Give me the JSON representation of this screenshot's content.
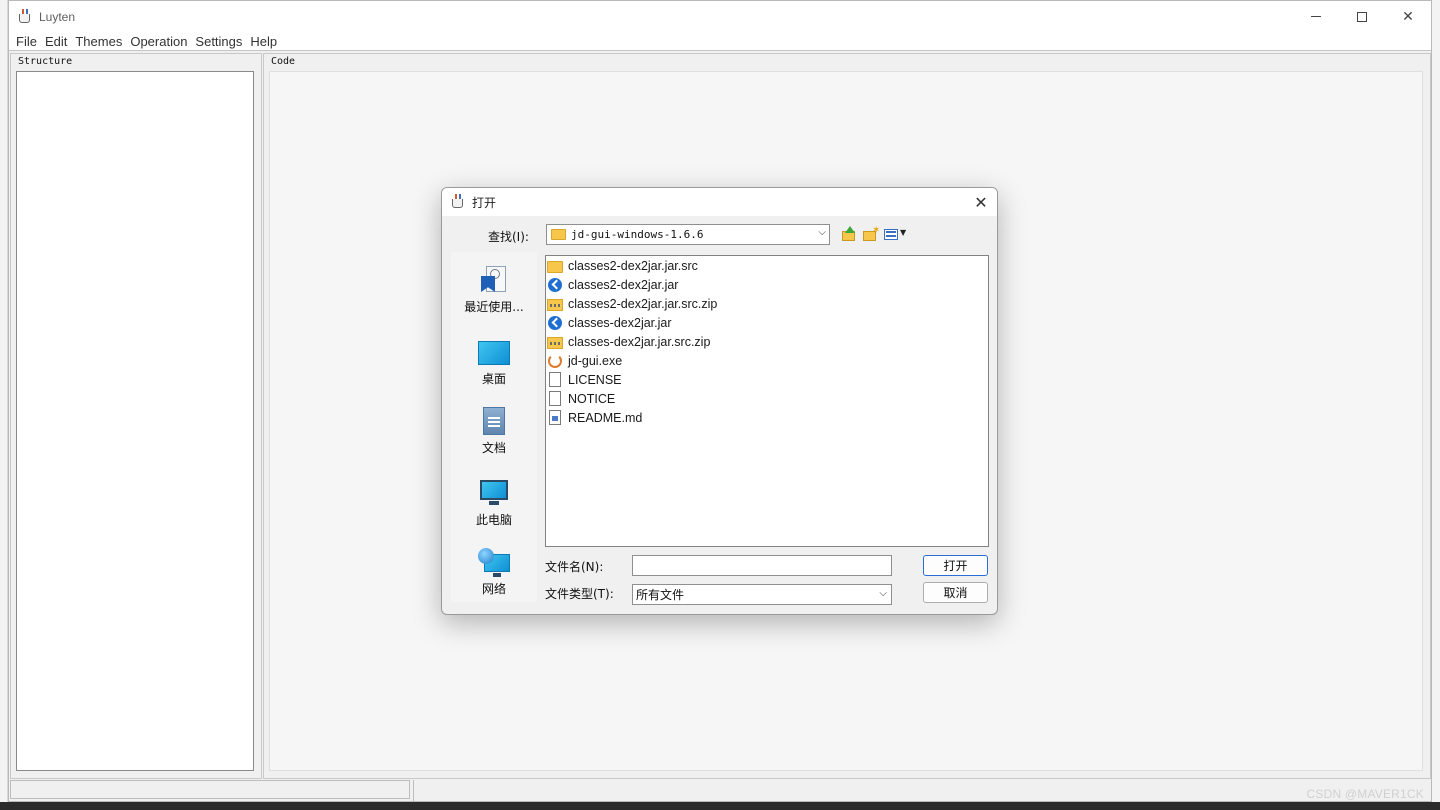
{
  "window": {
    "title": "Luyten",
    "menu": [
      "File",
      "Edit",
      "Themes",
      "Operation",
      "Settings",
      "Help"
    ]
  },
  "panels": {
    "structure_label": "Structure",
    "code_label": "Code"
  },
  "dialog": {
    "title": "打开",
    "look_in_label": "查找(I):",
    "look_in_value": "jd-gui-windows-1.6.6",
    "places": [
      {
        "label": "最近使用...",
        "icon": "recent-places-icon"
      },
      {
        "label": "桌面",
        "icon": "desktop-icon"
      },
      {
        "label": "文档",
        "icon": "documents-icon"
      },
      {
        "label": "此电脑",
        "icon": "this-pc-icon"
      },
      {
        "label": "网络",
        "icon": "network-icon"
      }
    ],
    "files": [
      {
        "name": "classes2-dex2jar.jar.src",
        "icon": "folder-icon"
      },
      {
        "name": "classes2-dex2jar.jar",
        "icon": "jar-file-icon"
      },
      {
        "name": "classes2-dex2jar.jar.src.zip",
        "icon": "zip-file-icon"
      },
      {
        "name": "classes-dex2jar.jar",
        "icon": "jar-file-icon"
      },
      {
        "name": "classes-dex2jar.jar.src.zip",
        "icon": "zip-file-icon"
      },
      {
        "name": "jd-gui.exe",
        "icon": "exe-file-icon"
      },
      {
        "name": "LICENSE",
        "icon": "document-file-icon"
      },
      {
        "name": "NOTICE",
        "icon": "document-file-icon"
      },
      {
        "name": "README.md",
        "icon": "markdown-file-icon"
      }
    ],
    "file_name_label": "文件名(N):",
    "file_name_value": "",
    "file_type_label": "文件类型(T):",
    "file_type_value": "所有文件",
    "open_button": "打开",
    "cancel_button": "取消"
  },
  "watermark": "CSDN @MAVER1CK"
}
